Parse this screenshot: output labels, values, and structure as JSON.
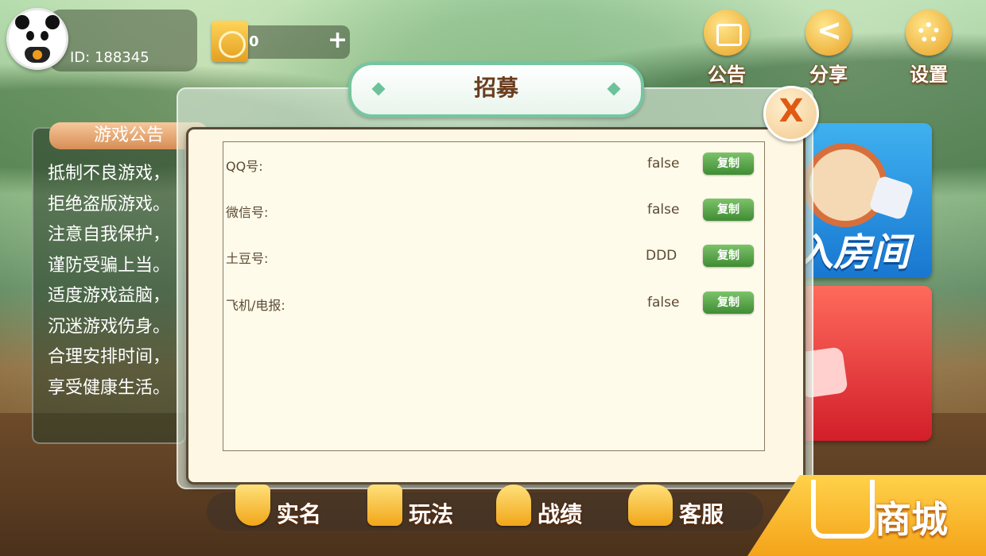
{
  "user": {
    "id_label": "ID: 188345",
    "coins": "0",
    "add_label": "+"
  },
  "top_menu": [
    {
      "label": "公告",
      "icon": "notice-board-icon"
    },
    {
      "label": "分享",
      "icon": "share-icon"
    },
    {
      "label": "设置",
      "icon": "gear-icon"
    }
  ],
  "notice": {
    "title": "游戏公告",
    "text": "抵制不良游戏，\n拒绝盗版游戏。\n注意自我保护，\n谨防受骗上当。\n适度游戏益脑，\n沉迷游戏伤身。\n合理安排时间，\n享受健康生活。"
  },
  "cards": {
    "join_room_text": "入房间"
  },
  "modal": {
    "title": "招募",
    "close_label": "X",
    "rows": [
      {
        "key": "QQ号:",
        "value": "false",
        "button": "复制"
      },
      {
        "key": "微信号:",
        "value": "false",
        "button": "复制"
      },
      {
        "key": "土豆号:",
        "value": "DDD",
        "button": "复制"
      },
      {
        "key": "飞机/电报:",
        "value": "false",
        "button": "复制"
      }
    ]
  },
  "bottom_menu": [
    {
      "label": "实名",
      "icon": "shield-check-icon"
    },
    {
      "label": "玩法",
      "icon": "document-icon"
    },
    {
      "label": "战绩",
      "icon": "medal-icon"
    },
    {
      "label": "客服",
      "icon": "headset-icon"
    }
  ],
  "shop": {
    "label": "商城",
    "icon": "shopping-cart-icon"
  },
  "colors": {
    "accent": "#f4a319",
    "copy_button": "#4f9b3f",
    "modal_bg": "#fdf7e3"
  }
}
